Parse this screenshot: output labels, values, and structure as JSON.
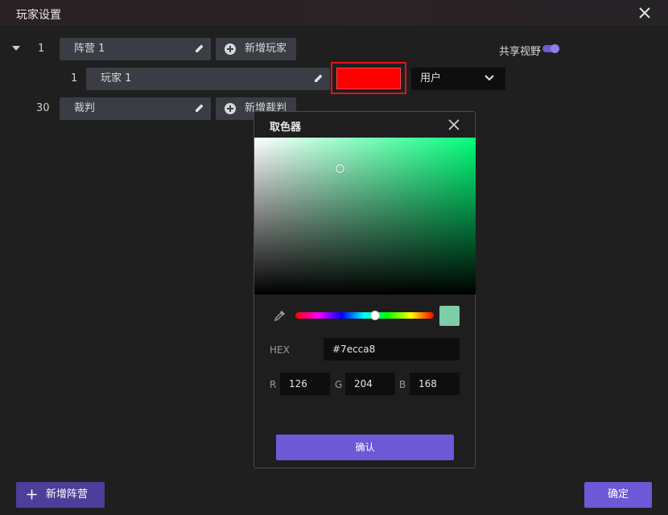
{
  "window": {
    "title": "玩家设置"
  },
  "share_view": {
    "label": "共享视野",
    "enabled": true
  },
  "camps": [
    {
      "index": "1",
      "name": "阵营 1",
      "add_label": "新增玩家",
      "players": [
        {
          "index": "1",
          "name": "玩家 1",
          "color": "#ff0000",
          "role": "用户"
        }
      ]
    },
    {
      "index": "30",
      "name": "裁判",
      "add_label": "新增裁判"
    }
  ],
  "color_picker": {
    "title": "取色器",
    "hex_label": "HEX",
    "hex_value": "#7ecca8",
    "r_label": "R",
    "r_value": "126",
    "g_label": "G",
    "g_value": "204",
    "b_label": "B",
    "b_value": "168",
    "hue_color": "#00ff7a",
    "preview_color": "#7ecca8",
    "confirm_label": "确认"
  },
  "footer": {
    "add_camp_label": "新增阵营",
    "ok_label": "确定"
  },
  "colors": {
    "accent": "#6f58d6",
    "highlight_outline": "#e0151b"
  }
}
